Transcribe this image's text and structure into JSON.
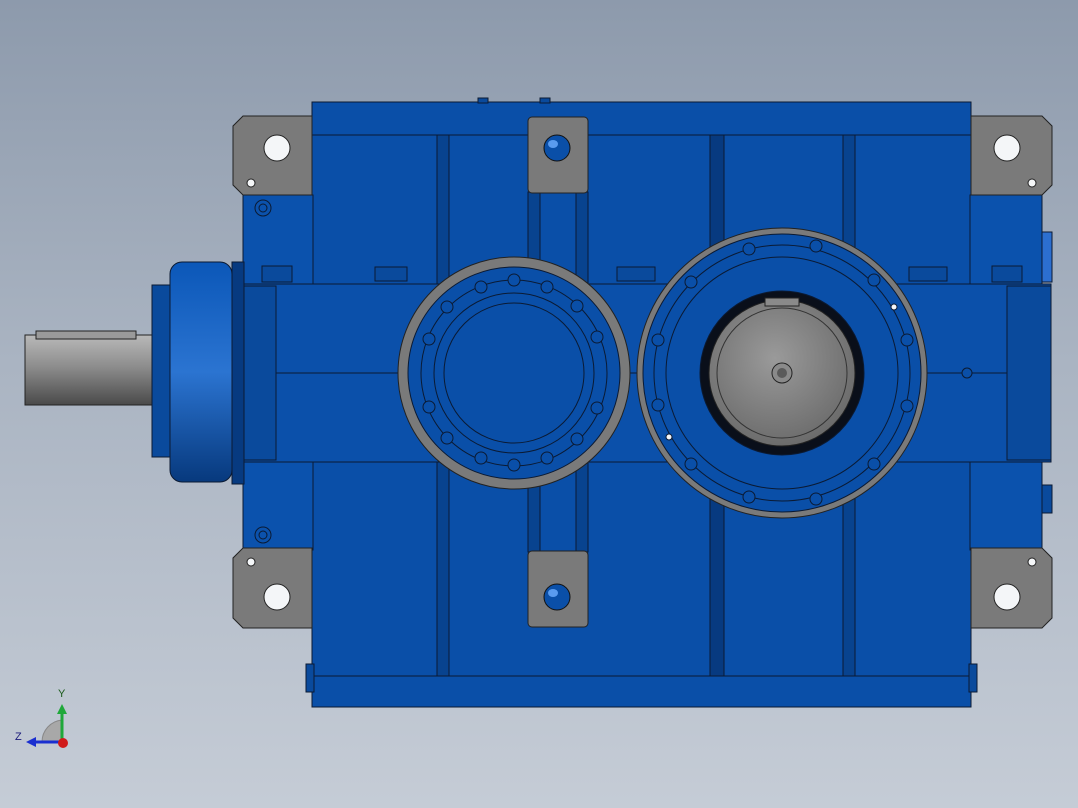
{
  "view": {
    "background_top": "#8d9aac",
    "background_bottom": "#c5ccd6"
  },
  "model": {
    "subject": "gearbox-housing",
    "housing_color": "#0a4fa8",
    "housing_dark": "#073a80",
    "flange_color": "#7a7a7a",
    "shaft_color": "#8a8a8a",
    "edge_color": "#0b1a33"
  },
  "triad": {
    "y_label": "Y",
    "z_label": "Z",
    "y_color": "#1fa83a",
    "z_color": "#1a2fd0",
    "x_color": "#d01a1a"
  }
}
